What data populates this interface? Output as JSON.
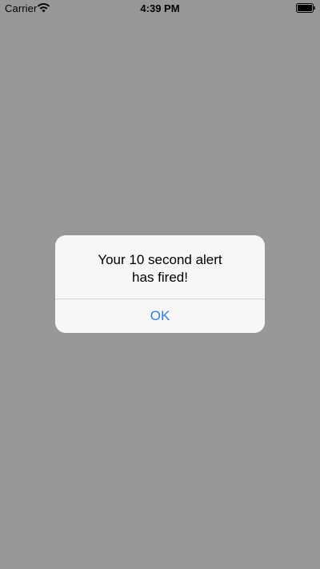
{
  "status_bar": {
    "carrier": "Carrier",
    "time": "4:39 PM",
    "icons": [
      "wifi-icon",
      "battery-icon"
    ]
  },
  "alert": {
    "title_line1": "Your 10 second alert",
    "title_line2": "has fired!",
    "ok_label": "OK",
    "button_color": "#2a7bf2"
  },
  "colors": {
    "background_dim": "#989898",
    "alert_background": "#f7f7f7"
  }
}
